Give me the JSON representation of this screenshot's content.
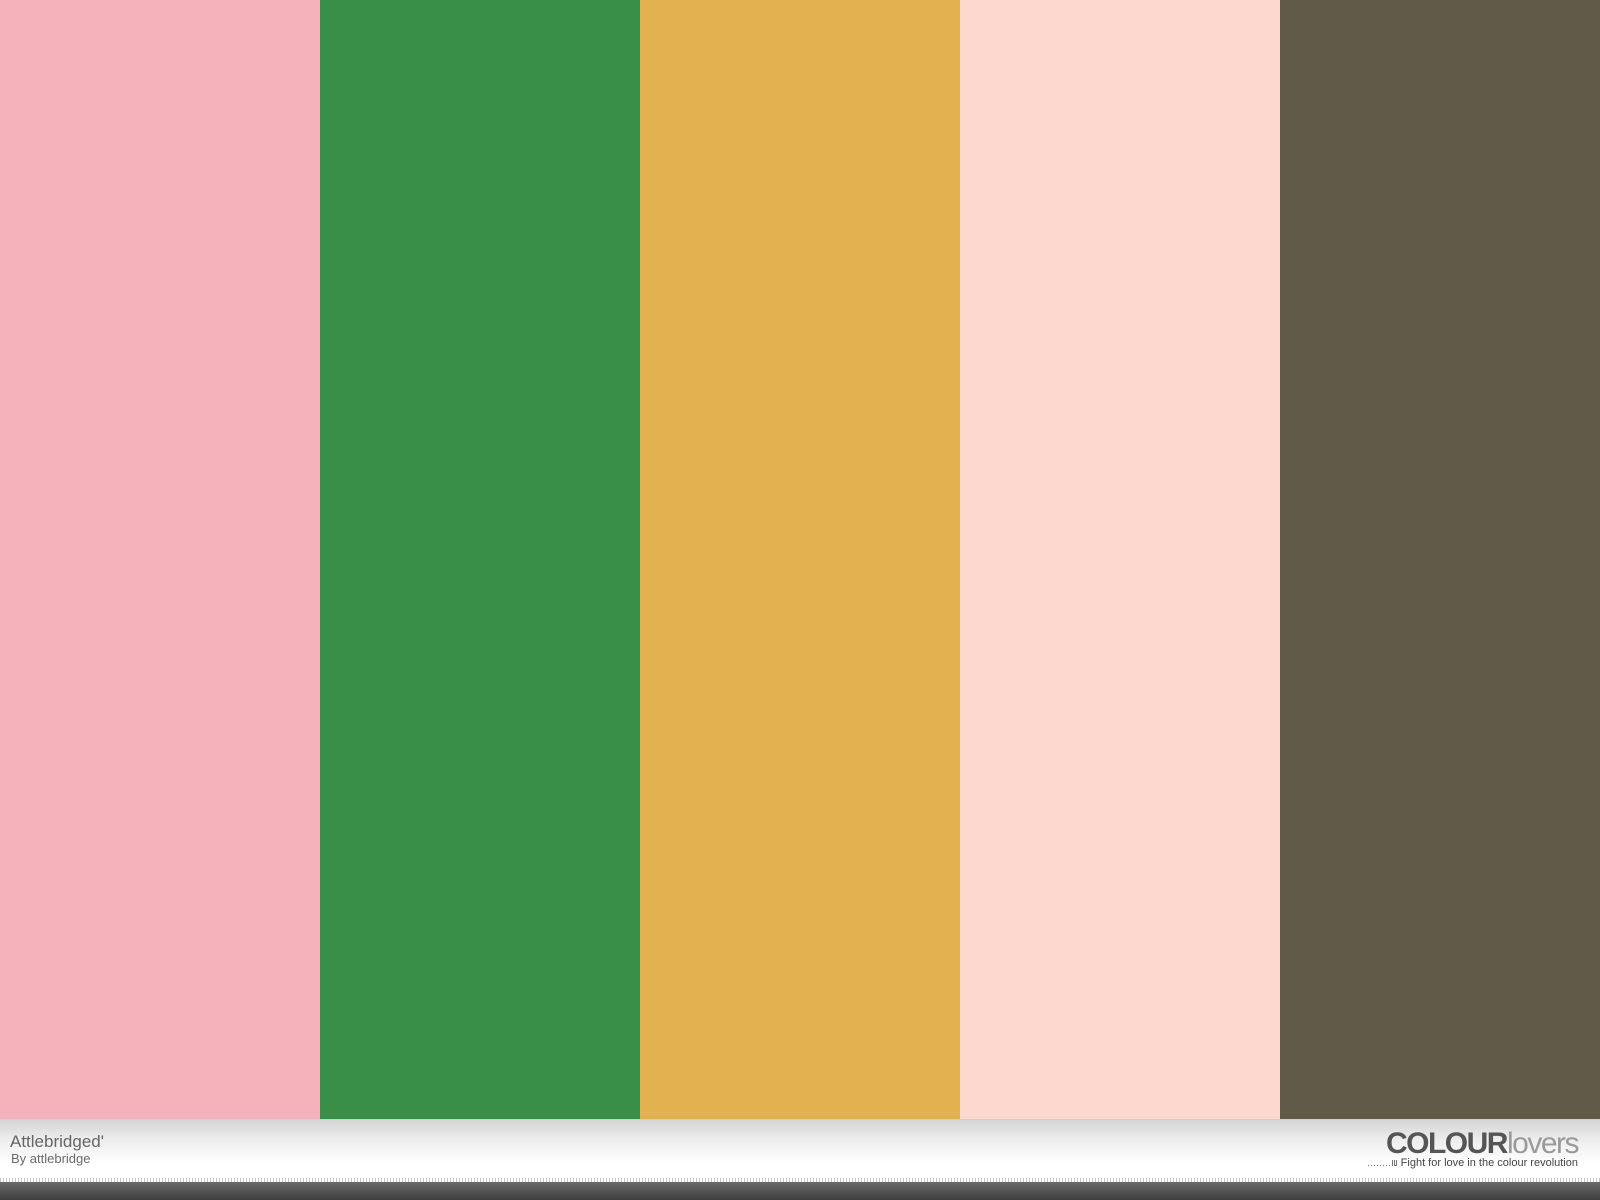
{
  "palette": {
    "title": "Attlebridged'",
    "author": "By attlebridge",
    "colors": [
      "#F4B3BA",
      "#3A8F48",
      "#E2B250",
      "#FDD8CE",
      "#625A48"
    ]
  },
  "brand": {
    "strong": "COLOUR",
    "light": "lovers",
    "tagline": "Fight for love in the colour revolution"
  }
}
